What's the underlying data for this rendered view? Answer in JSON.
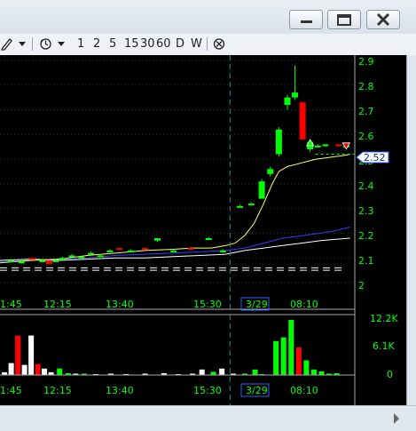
{
  "window": {
    "controls": [
      "minimize",
      "maximize",
      "close"
    ]
  },
  "toolbar": {
    "timeframes": [
      "1",
      "2",
      "5",
      "15",
      "30",
      "60",
      "D",
      "W"
    ]
  },
  "price_axis": {
    "ticks": [
      "2.9",
      "2.8",
      "2.7",
      "2.6",
      "2.5",
      "2.4",
      "2.3",
      "2.2",
      "2.1",
      "2"
    ],
    "last_price": "2.52"
  },
  "volume_axis": {
    "ticks": [
      "12.2K",
      "6.1K",
      "0"
    ]
  },
  "time_axis": {
    "labels": [
      "1:45",
      "12:15",
      "13:40",
      "15:30",
      "3/29",
      "08:10"
    ]
  },
  "colors": {
    "up": "#00ff00",
    "down": "#ff0000",
    "neutral_volume": "#ffffff",
    "ma_fast": "#ffff66",
    "ma_mid": "#3040ff",
    "ma_slow": "#ffffff",
    "grid": "#0b4a1a",
    "session_divider": "#2a8a8a",
    "last_price_bg": "#ffffff"
  },
  "chart_data": {
    "type": "candlestick",
    "price_range": [
      2.0,
      2.9
    ],
    "volume_range": [
      0,
      12200
    ],
    "grid": true,
    "candles": [
      {
        "t": 0.9,
        "o": 2.09,
        "h": 2.095,
        "l": 2.085,
        "c": 2.09
      },
      {
        "t": 2.0,
        "o": 2.085,
        "h": 2.09,
        "l": 2.08,
        "c": 2.085
      },
      {
        "t": 3.1,
        "o": 2.1,
        "h": 2.1,
        "l": 2.095,
        "c": 2.095
      },
      {
        "t": 4.2,
        "o": 2.09,
        "h": 2.095,
        "l": 2.085,
        "c": 2.09
      },
      {
        "t": 4.9,
        "o": 2.09,
        "h": 2.09,
        "l": 2.075,
        "c": 2.075
      },
      {
        "t": 5.6,
        "o": 2.09,
        "h": 2.095,
        "l": 2.085,
        "c": 2.09
      },
      {
        "t": 6.3,
        "o": 2.1,
        "h": 2.105,
        "l": 2.095,
        "c": 2.1
      },
      {
        "t": 7.3,
        "o": 2.11,
        "h": 2.115,
        "l": 2.105,
        "c": 2.11
      },
      {
        "t": 8.3,
        "o": 2.1,
        "h": 2.105,
        "l": 2.1,
        "c": 2.105
      },
      {
        "t": 9.3,
        "o": 2.12,
        "h": 2.125,
        "l": 2.115,
        "c": 2.12
      },
      {
        "t": 10.3,
        "o": 2.11,
        "h": 2.115,
        "l": 2.105,
        "c": 2.11
      },
      {
        "t": 11.3,
        "o": 2.13,
        "h": 2.135,
        "l": 2.125,
        "c": 2.13
      },
      {
        "t": 12.3,
        "o": 2.14,
        "h": 2.14,
        "l": 2.135,
        "c": 2.135
      },
      {
        "t": 13.5,
        "o": 2.13,
        "h": 2.135,
        "l": 2.13,
        "c": 2.13
      },
      {
        "t": 15.0,
        "o": 2.14,
        "h": 2.14,
        "l": 2.135,
        "c": 2.135
      },
      {
        "t": 16.3,
        "o": 2.17,
        "h": 2.18,
        "l": 2.165,
        "c": 2.18
      },
      {
        "t": 18.0,
        "o": 2.13,
        "h": 2.135,
        "l": 2.13,
        "c": 2.13
      },
      {
        "t": 19.8,
        "o": 2.14,
        "h": 2.14,
        "l": 2.135,
        "c": 2.135
      },
      {
        "t": 21.7,
        "o": 2.18,
        "h": 2.185,
        "l": 2.18,
        "c": 2.18
      },
      {
        "t": 23.2,
        "o": 2.13,
        "h": 2.135,
        "l": 2.13,
        "c": 2.13
      },
      {
        "t": 25.0,
        "o": 2.31,
        "h": 2.315,
        "l": 2.31,
        "c": 2.31
      },
      {
        "t": 26.2,
        "o": 2.32,
        "h": 2.325,
        "l": 2.32,
        "c": 2.32
      },
      {
        "t": 27.3,
        "o": 2.34,
        "h": 2.42,
        "l": 2.34,
        "c": 2.41
      },
      {
        "t": 28.2,
        "o": 2.44,
        "h": 2.47,
        "l": 2.43,
        "c": 2.46
      },
      {
        "t": 29.1,
        "o": 2.52,
        "h": 2.63,
        "l": 2.51,
        "c": 2.62
      },
      {
        "t": 30.0,
        "o": 2.72,
        "h": 2.76,
        "l": 2.7,
        "c": 2.75
      },
      {
        "t": 30.8,
        "o": 2.75,
        "h": 2.88,
        "l": 2.74,
        "c": 2.77
      },
      {
        "t": 31.6,
        "o": 2.73,
        "h": 2.73,
        "l": 2.58,
        "c": 2.58
      },
      {
        "t": 32.4,
        "o": 2.54,
        "h": 2.58,
        "l": 2.53,
        "c": 2.57
      },
      {
        "t": 33.2,
        "o": 2.55,
        "h": 2.56,
        "l": 2.55,
        "c": 2.555
      },
      {
        "t": 34.0,
        "o": 2.555,
        "h": 2.56,
        "l": 2.55,
        "c": 2.56
      },
      {
        "t": 35.4,
        "o": 2.56,
        "h": 2.56,
        "l": 2.55,
        "c": 2.555
      },
      {
        "t": 36.2,
        "o": 2.555,
        "h": 2.56,
        "l": 2.55,
        "c": 2.555
      }
    ],
    "volumes": [
      {
        "t": 0.2,
        "v": 600,
        "c": "#ffffff"
      },
      {
        "t": 0.9,
        "v": 2600,
        "c": "#ffffff"
      },
      {
        "t": 1.6,
        "v": 8600,
        "c": "#ff0000"
      },
      {
        "t": 2.3,
        "v": 2200,
        "c": "#ffffff"
      },
      {
        "t": 3.0,
        "v": 8600,
        "c": "#ffffff"
      },
      {
        "t": 3.7,
        "v": 2400,
        "c": "#ff0000"
      },
      {
        "t": 4.4,
        "v": 1400,
        "c": "#ffffff"
      },
      {
        "t": 5.1,
        "v": 600,
        "c": "#ffffff"
      },
      {
        "t": 6.0,
        "v": 1400,
        "c": "#00ff00"
      },
      {
        "t": 6.9,
        "v": 400,
        "c": "#00ff00"
      },
      {
        "t": 7.7,
        "v": 300,
        "c": "#ffffff"
      },
      {
        "t": 8.6,
        "v": 300,
        "c": "#00ff00"
      },
      {
        "t": 9.8,
        "v": 200,
        "c": "#ffffff"
      },
      {
        "t": 11.4,
        "v": 300,
        "c": "#ffffff"
      },
      {
        "t": 13.0,
        "v": 200,
        "c": "#ffffff"
      },
      {
        "t": 15.0,
        "v": 300,
        "c": "#ffffff"
      },
      {
        "t": 17.0,
        "v": 400,
        "c": "#ffffff"
      },
      {
        "t": 18.5,
        "v": 200,
        "c": "#ffffff"
      },
      {
        "t": 20.0,
        "v": 300,
        "c": "#ffffff"
      },
      {
        "t": 21.0,
        "v": 1200,
        "c": "#ffffff"
      },
      {
        "t": 22.2,
        "v": 700,
        "c": "#00ff00"
      },
      {
        "t": 23.1,
        "v": 1400,
        "c": "#ffffff"
      },
      {
        "t": 24.3,
        "v": 300,
        "c": "#ffffff"
      },
      {
        "t": 25.5,
        "v": 300,
        "c": "#00ff00"
      },
      {
        "t": 26.6,
        "v": 1200,
        "c": "#00ff00"
      },
      {
        "t": 27.3,
        "v": 200,
        "c": "#00ff00"
      },
      {
        "t": 28.8,
        "v": 7400,
        "c": "#00ff00"
      },
      {
        "t": 29.6,
        "v": 8200,
        "c": "#00ff00"
      },
      {
        "t": 30.4,
        "v": 12000,
        "c": "#00ff00"
      },
      {
        "t": 31.2,
        "v": 6000,
        "c": "#ff0000"
      },
      {
        "t": 32.0,
        "v": 3200,
        "c": "#00ff00"
      },
      {
        "t": 32.8,
        "v": 1200,
        "c": "#00ff00"
      },
      {
        "t": 33.6,
        "v": 800,
        "c": "#00ff00"
      },
      {
        "t": 34.4,
        "v": 300,
        "c": "#00ff00"
      },
      {
        "t": 35.2,
        "v": 400,
        "c": "#00ff00"
      }
    ],
    "ma_fast": [
      [
        -0.3,
        2.08
      ],
      [
        3,
        2.09
      ],
      [
        6,
        2.095
      ],
      [
        9,
        2.11
      ],
      [
        12,
        2.12
      ],
      [
        15,
        2.13
      ],
      [
        18,
        2.135
      ],
      [
        20,
        2.14
      ],
      [
        22,
        2.14
      ],
      [
        23.5,
        2.15
      ],
      [
        24.5,
        2.16
      ],
      [
        25.5,
        2.19
      ],
      [
        26.5,
        2.24
      ],
      [
        27.5,
        2.32
      ],
      [
        28.4,
        2.4
      ],
      [
        29.1,
        2.45
      ],
      [
        30,
        2.47
      ],
      [
        31,
        2.48
      ],
      [
        32,
        2.49
      ],
      [
        33,
        2.5
      ],
      [
        34,
        2.505
      ],
      [
        35,
        2.51
      ],
      [
        36,
        2.515
      ],
      [
        36.6,
        2.52
      ]
    ],
    "ma_mid": [
      [
        -0.3,
        2.085
      ],
      [
        3,
        2.09
      ],
      [
        6,
        2.095
      ],
      [
        9,
        2.1
      ],
      [
        12,
        2.11
      ],
      [
        15,
        2.115
      ],
      [
        18,
        2.12
      ],
      [
        21,
        2.125
      ],
      [
        23.5,
        2.13
      ],
      [
        25.5,
        2.14
      ],
      [
        27.5,
        2.16
      ],
      [
        29.5,
        2.18
      ],
      [
        31.5,
        2.19
      ],
      [
        33.5,
        2.2
      ],
      [
        35,
        2.21
      ],
      [
        36.6,
        2.225
      ]
    ],
    "ma_slow": [
      [
        -0.3,
        2.09
      ],
      [
        3,
        2.095
      ],
      [
        6,
        2.09
      ],
      [
        9,
        2.095
      ],
      [
        12,
        2.1
      ],
      [
        15,
        2.1
      ],
      [
        18,
        2.105
      ],
      [
        21,
        2.11
      ],
      [
        23.5,
        2.115
      ],
      [
        25.5,
        2.13
      ],
      [
        27.5,
        2.14
      ],
      [
        29.5,
        2.15
      ],
      [
        31.5,
        2.16
      ],
      [
        33.5,
        2.17
      ],
      [
        35,
        2.175
      ],
      [
        36.6,
        2.18
      ]
    ],
    "ref_lines": [
      {
        "y": 2.06,
        "dash": true
      },
      {
        "y": 2.05,
        "dash": true
      }
    ],
    "session_break_t": 24.0,
    "last_price": 2.52,
    "markers": [
      {
        "t": 32.4,
        "y": 2.565,
        "type": "triangle-up",
        "color": "#00ff00"
      },
      {
        "t": 36.2,
        "y": 2.555,
        "type": "triangle-down",
        "color": "#ff0000"
      }
    ]
  }
}
